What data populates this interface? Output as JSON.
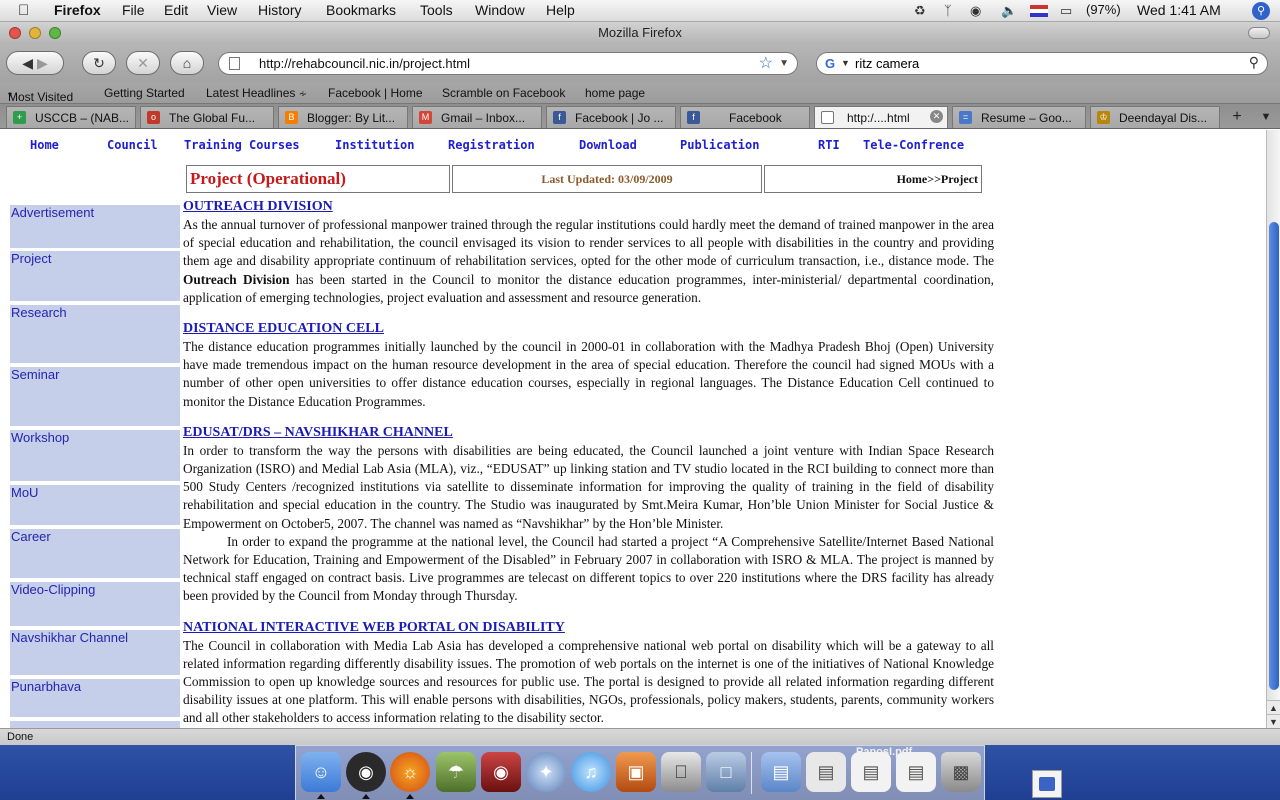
{
  "os_menubar": {
    "app_name": "Firefox",
    "menus": [
      "File",
      "Edit",
      "View",
      "History",
      "Bookmarks",
      "Tools",
      "Window",
      "Help"
    ],
    "battery": "(97%)",
    "clock": "Wed 1:41 AM"
  },
  "window": {
    "title": "Mozilla Firefox"
  },
  "navbar": {
    "url": "http://rehabcouncil.nic.in/project.html",
    "search_value": "ritz camera"
  },
  "bookmarks": [
    "Most Visited",
    "Getting Started",
    "Latest Headlines",
    "Facebook | Home",
    "Scramble on Facebook",
    "home page"
  ],
  "tabs": [
    {
      "label": "USCCB – (NAB...",
      "icon": "cross-icon",
      "color": "#2e9c4a"
    },
    {
      "label": "The Global Fu...",
      "icon": "globe-icon",
      "color": "#c0392b"
    },
    {
      "label": "Blogger: By Lit...",
      "icon": "blogger-icon",
      "color": "#f57d00"
    },
    {
      "label": "Gmail – Inbox...",
      "icon": "mail-icon",
      "color": "#d44638"
    },
    {
      "label": "Facebook | Jo ...",
      "icon": "facebook-icon",
      "color": "#3b5998"
    },
    {
      "label": "Facebook",
      "icon": "facebook-icon",
      "color": "#3b5998"
    },
    {
      "label": "http:/....html",
      "icon": "page-icon",
      "color": "#ffffff",
      "active": true
    },
    {
      "label": "Resume – Goo...",
      "icon": "doc-icon",
      "color": "#4a78c8"
    },
    {
      "label": "Deendayal Dis...",
      "icon": "emblem-icon",
      "color": "#b8860b"
    }
  ],
  "site": {
    "nav": [
      "Home",
      "Council",
      "Training Courses",
      "Institution",
      "Registration",
      "Download",
      "Publication",
      "RTI",
      "Tele-Confrence"
    ],
    "page_title": "Project (Operational)",
    "last_updated": "Last Updated: 03/09/2009",
    "breadcrumb": "Home>>Project",
    "sidebar": [
      "Advertisement",
      "Project",
      "Research",
      "Seminar",
      "Workshop",
      "MoU",
      "Career",
      "Video-Clipping",
      "Navshikhar Channel",
      "Punarbhava"
    ],
    "sections": [
      {
        "heading": "OUTREACH DIVISION",
        "para1_a": "As the annual turnover of professional manpower trained through the regular institutions could hardly meet the demand of trained manpower in the area of special education and rehabilitation, the council envisaged its vision to render services to all people with disabilities in the country and providing them age and disability appropriate continuum of rehabilitation services, opted for the other mode of curriculum transaction, i.e., distance mode. The",
        "para1_bold": "Outreach Division",
        "para1_b": "has been started in the Council to monitor the distance education programmes, inter-ministerial/ departmental coordination, application of emerging technologies, project evaluation and assessment and resource generation."
      },
      {
        "heading": "DISTANCE EDUCATION CELL",
        "para1": "The distance education programmes initially launched by the council in 2000-01 in collaboration with the Madhya Pradesh Bhoj (Open) University have made tremendous impact on the human resource development in the area of special education. Therefore the council had signed MOUs with a number of other open universities to offer distance education courses, especially in regional languages. The Distance Education Cell continued to monitor the Distance Education Programmes."
      },
      {
        "heading": "EDUSAT/DRS – NAVSHIKHAR CHANNEL",
        "para1": "In order to transform the way the persons with disabilities are being educated, the Council launched a joint venture with Indian Space Research Organization (ISRO) and Medial Lab Asia (MLA), viz., “EDUSAT” up linking station and TV studio located in the RCI building to connect more than 500 Study Centers /recognized institutions via satellite to disseminate information for improving the quality of training in the field of disability rehabilitation and special education in the country. The Studio was inaugurated by Smt.Meira Kumar, Hon’ble Union Minister for Social Justice & Empowerment on October5, 2007. The channel was named as “Navshikhar” by the Hon’ble Minister.",
        "para2": "In order to expand the programme at the national level, the Council had started a project “A Comprehensive Satellite/Internet Based National Network for Education, Training and Empowerment of the Disabled” in February 2007 in collaboration with ISRO & MLA. The project is manned by technical staff engaged on contract basis. Live programmes are telecast on different topics to over 220 institutions where the DRS facility has already been provided by the Council from Monday through Thursday."
      },
      {
        "heading": "NATIONAL INTERACTIVE WEB PORTAL ON DISABILITY",
        "para1": "The Council in collaboration with Media Lab Asia has developed a comprehensive national web portal on disability which will be a gateway to all related information regarding differently disability issues. The promotion of web portals on the internet is one of the initiatives of National Knowledge Commission to open up knowledge sources and resources for public use. The portal is designed to provide all related information regarding different disability issues at one platform. This will enable persons with disabilities, NGOs, professionals, policy makers, students, parents, community workers and all other stakeholders to access information relating to the disability sector."
      }
    ]
  },
  "statusbar": {
    "text": "Done"
  },
  "dock": {
    "label": "PanosI.pdf",
    "apps": [
      {
        "name": "finder-icon",
        "color": "#4a8fe0"
      },
      {
        "name": "dashboard-icon",
        "color": "#333333"
      },
      {
        "name": "firefox-icon",
        "color": "#e66000"
      },
      {
        "name": "iphoto-icon",
        "color": "#6b8f3a"
      },
      {
        "name": "photo-booth-icon",
        "color": "#8a1c1c"
      },
      {
        "name": "safari-icon",
        "color": "#5b7fb8"
      },
      {
        "name": "itunes-icon",
        "color": "#3a8fe0"
      },
      {
        "name": "keynote-icon",
        "color": "#c05a1a"
      },
      {
        "name": "system-preferences-icon",
        "color": "#8c8c8c"
      },
      {
        "name": "preview-icon",
        "color": "#5f7fa8"
      },
      {
        "name": "textedit-icon",
        "color": "#d8d8d8"
      }
    ],
    "docs": [
      {
        "name": "window-thumbnail-icon",
        "color": "#5a86c8"
      },
      {
        "name": "window-thumbnail-icon",
        "color": "#e0e0e0"
      },
      {
        "name": "document-thumbnail-icon",
        "color": "#f0f0f0"
      },
      {
        "name": "document-thumbnail-icon",
        "color": "#f0f0f0"
      },
      {
        "name": "trash-icon",
        "color": "#9a9a9a"
      }
    ]
  }
}
